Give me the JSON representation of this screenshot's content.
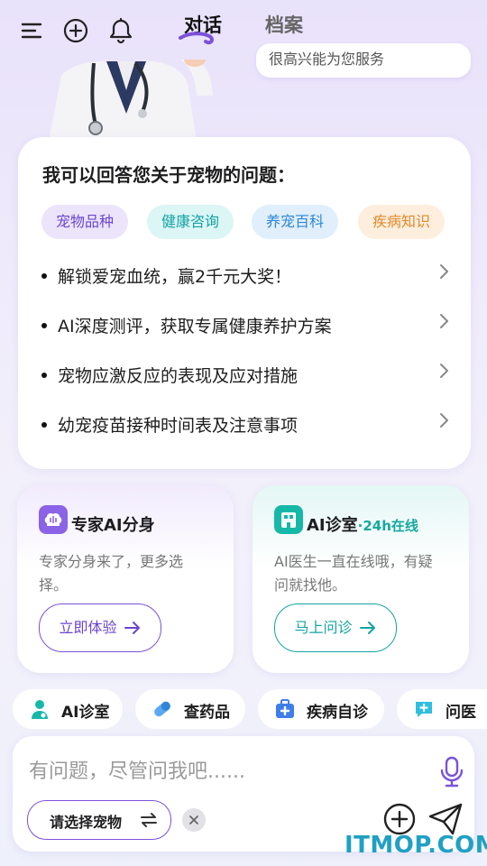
{
  "header": {
    "tabs": [
      {
        "label": "对话",
        "active": true
      },
      {
        "label": "档案",
        "active": false
      }
    ],
    "icons": [
      "menu-icon",
      "add-circle-icon",
      "bell-icon"
    ],
    "accent": "#7b52d9"
  },
  "hero": {
    "bubble_text": "很高兴能为您服务"
  },
  "main_card": {
    "title": "我可以回答您关于宠物的问题：",
    "chips": [
      {
        "label": "宠物品种",
        "color": "#6b45d1"
      },
      {
        "label": "健康咨询",
        "color": "#15a3a3"
      },
      {
        "label": "养宠百科",
        "color": "#2f86d8"
      },
      {
        "label": "疾病知识",
        "color": "#e08a2c"
      }
    ],
    "questions": [
      "解锁爱宠血统，赢2千元大奖！",
      "AI深度测评，获取专属健康养护方案",
      "宠物应激反应的表现及应对措施",
      "幼宠疫苗接种时间表及注意事项"
    ]
  },
  "features": [
    {
      "title": "专家AI分身",
      "subtitle": "",
      "desc": "专家分身来了，更多选择。",
      "button": "立即体验"
    },
    {
      "title": "AI诊室",
      "subtitle": "·24h在线",
      "desc": "AI医生一直在线哦，有疑问就找他。",
      "button": "马上问诊"
    }
  ],
  "shortcuts": [
    {
      "label": "AI诊室",
      "icon": "doctor-icon"
    },
    {
      "label": "查药品",
      "icon": "pill-icon"
    },
    {
      "label": "疾病自诊",
      "icon": "medkit-icon"
    },
    {
      "label": "问医",
      "icon": "chat-plus-icon"
    }
  ],
  "composer": {
    "placeholder": "有问题，尽管问我吧......",
    "pet_select": "请选择宠物"
  },
  "watermark": "ITMOP.COM"
}
